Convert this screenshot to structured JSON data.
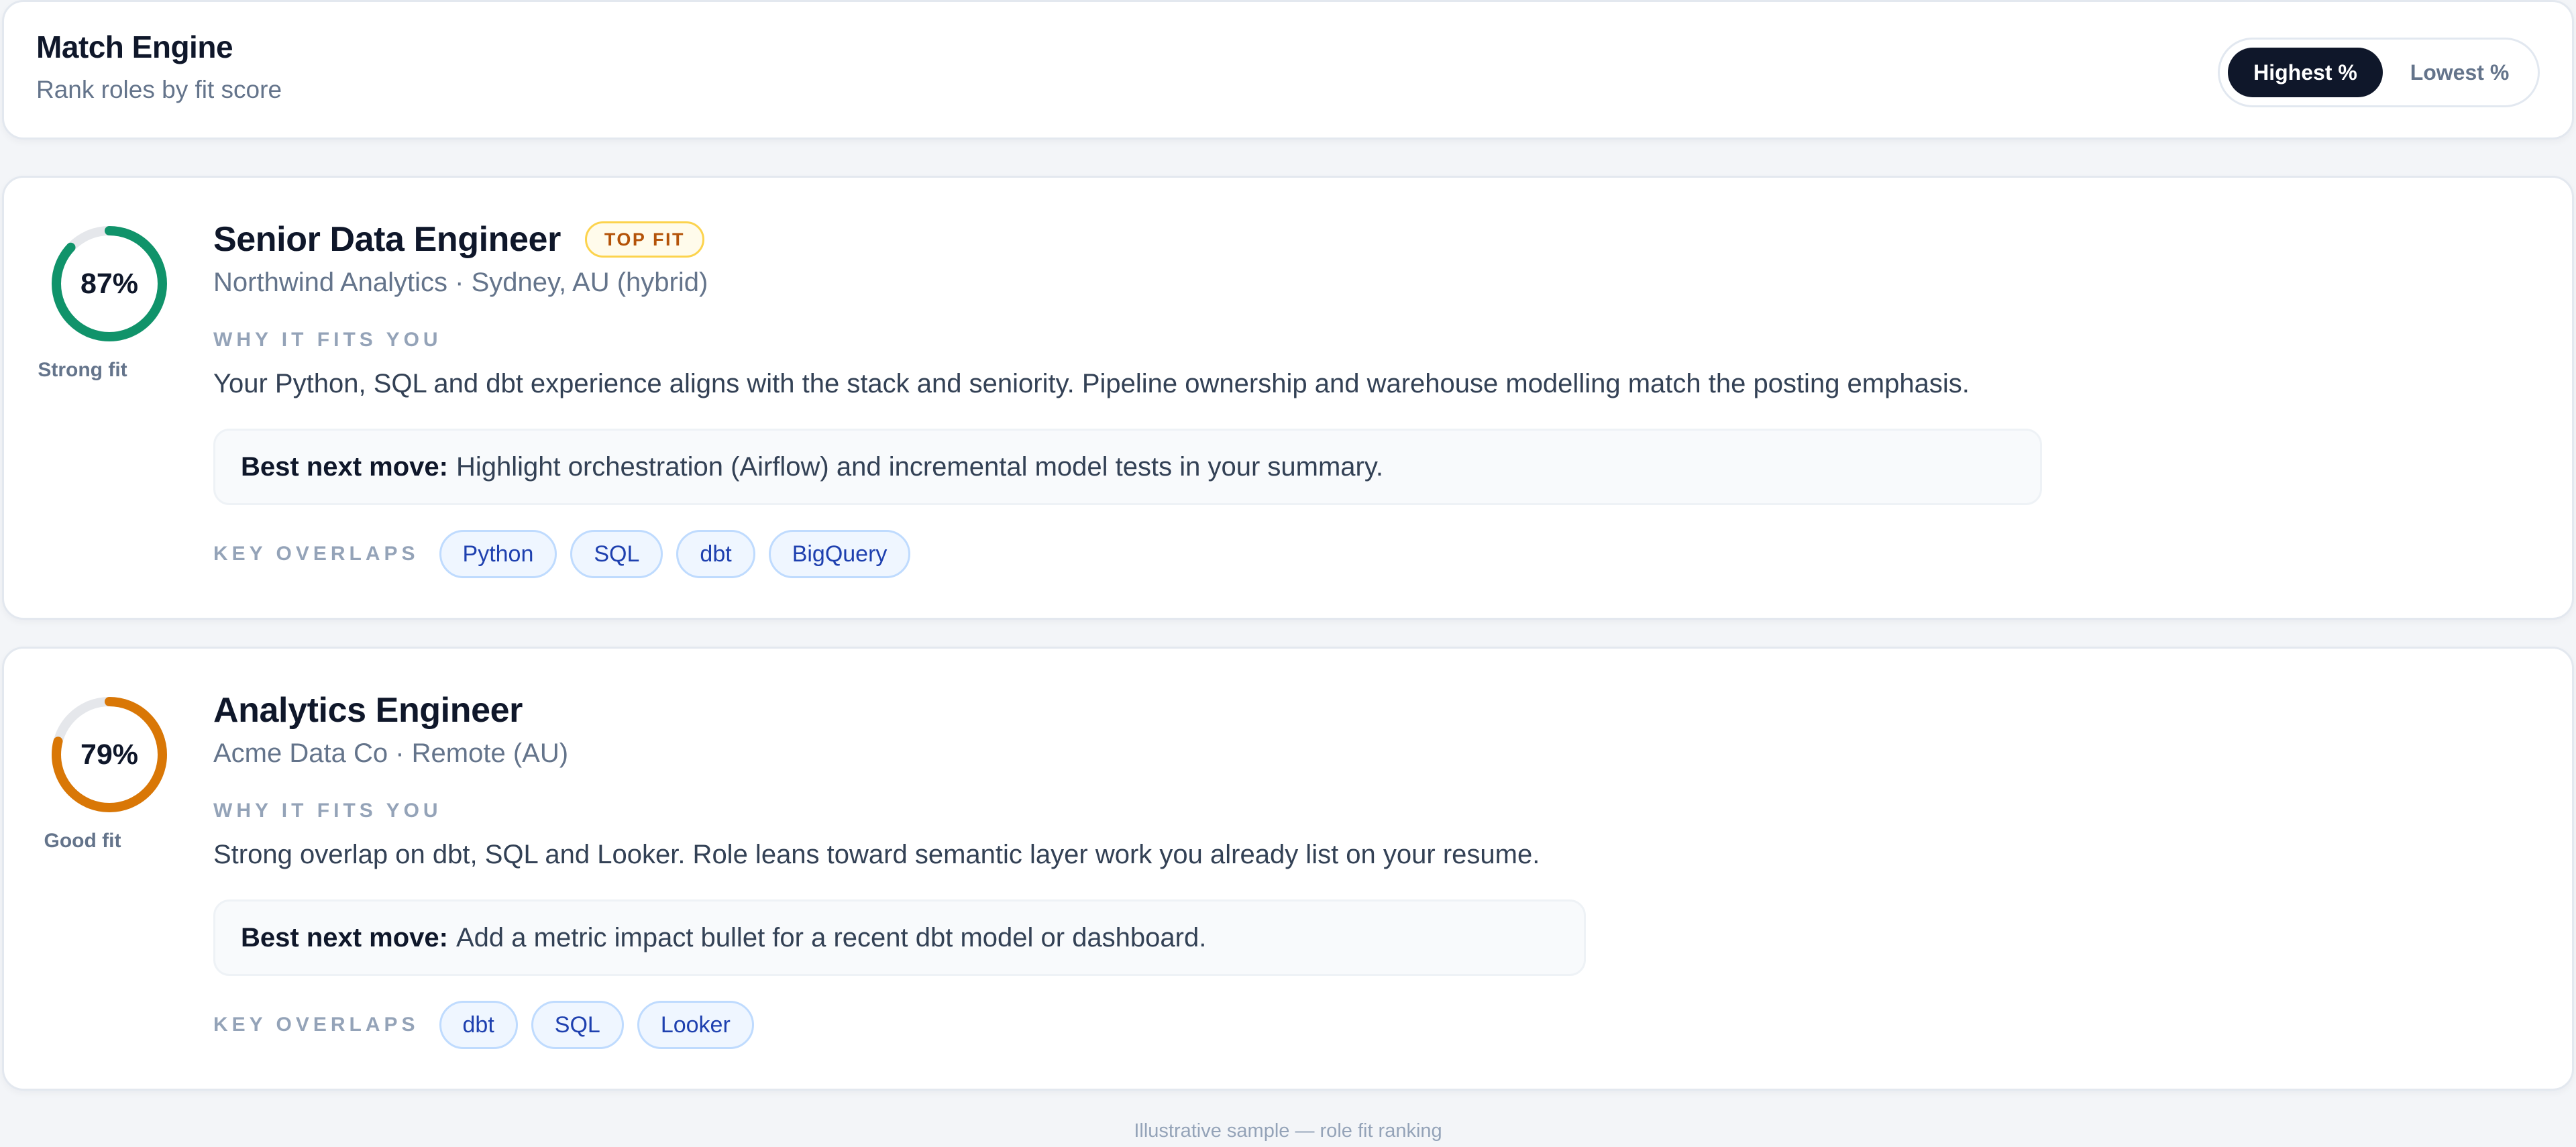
{
  "header": {
    "title": "Match Engine",
    "subtitle": "Rank roles by fit score",
    "sort_options": [
      {
        "label": "Highest %",
        "selected": true
      },
      {
        "label": "Lowest %",
        "selected": false
      }
    ]
  },
  "roles": [
    {
      "score_text": "87%",
      "score_value": 87,
      "score_color": "#10936a",
      "fit_label": "Strong fit",
      "title": "Senior Data Engineer",
      "badge": "TOP FIT",
      "company_location": "Northwind Analytics · Sydney, AU (hybrid)",
      "why_label": "WHY IT FITS YOU",
      "why_text": "Your Python, SQL and dbt experience aligns with the stack and seniority. Pipeline ownership and warehouse modelling match the posting emphasis.",
      "next_move_title": "Best next move:",
      "next_move_text": "Highlight orchestration (Airflow) and incremental model tests in your summary.",
      "overlaps_label": "KEY OVERLAPS",
      "overlaps": [
        "Python",
        "SQL",
        "dbt",
        "BigQuery"
      ]
    },
    {
      "score_text": "79%",
      "score_value": 79,
      "score_color": "#d97706",
      "fit_label": "Good fit",
      "title": "Analytics Engineer",
      "badge": "",
      "company_location": "Acme Data Co · Remote (AU)",
      "why_label": "WHY IT FITS YOU",
      "why_text": "Strong overlap on dbt, SQL and Looker. Role leans toward semantic layer work you already list on your resume.",
      "next_move_title": "Best next move:",
      "next_move_text": "Add a metric impact bullet for a recent dbt model or dashboard.",
      "overlaps_label": "KEY OVERLAPS",
      "overlaps": [
        "dbt",
        "SQL",
        "Looker"
      ]
    }
  ],
  "footer": {
    "note": "Illustrative sample — role fit ranking"
  },
  "colors": {
    "ring_track": "#e5e7eb",
    "accent_dark": "#0f172a"
  }
}
